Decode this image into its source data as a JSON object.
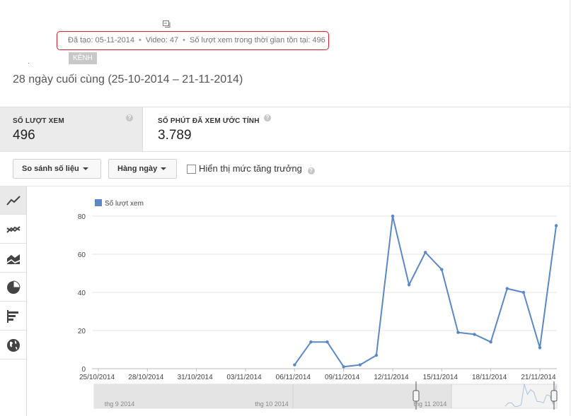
{
  "video_meta": {
    "created_label": "Đã tạo: 05-11-2014",
    "video_label": "Video: 47",
    "lifetime_views_label": "Số lượt xem trong thời gian tồn tại: 496",
    "channel_badge": "KÊNH",
    "export_icon": "export-icon"
  },
  "date_range_title": "28 ngày cuối cùng (25-10-2014 – 21-11-2014)",
  "metrics": [
    {
      "label": "SỐ LƯỢT XEM",
      "value": "496",
      "help_icon": "help-icon"
    },
    {
      "label": "SỐ PHÚT ĐÃ XEM ƯỚC TÍNH",
      "value": "3.789",
      "help_icon": "help-icon"
    }
  ],
  "toolbar": {
    "compare_label": "So sánh số liệu",
    "granularity_label": "Hàng ngày",
    "growth_checkbox_label": "Hiển thị mức tăng trưởng",
    "growth_checked": false
  },
  "side_rail": [
    {
      "name": "line-chart-icon",
      "active": true
    },
    {
      "name": "multi-line-chart-icon",
      "active": false
    },
    {
      "name": "stacked-area-chart-icon",
      "active": false
    },
    {
      "name": "pie-chart-icon",
      "active": false
    },
    {
      "name": "bar-chart-icon",
      "active": false
    },
    {
      "name": "globe-map-icon",
      "active": false
    }
  ],
  "chart_data": {
    "type": "line",
    "legend": "Số lượt xem",
    "legend_position": "top-left",
    "grid": true,
    "color": "#5b88c3",
    "x": [
      "2014-10-25",
      "2014-10-26",
      "2014-10-27",
      "2014-10-28",
      "2014-10-29",
      "2014-10-30",
      "2014-10-31",
      "2014-11-01",
      "2014-11-02",
      "2014-11-03",
      "2014-11-04",
      "2014-11-05",
      "2014-11-06",
      "2014-11-07",
      "2014-11-08",
      "2014-11-09",
      "2014-11-10",
      "2014-11-11",
      "2014-11-12",
      "2014-11-13",
      "2014-11-14",
      "2014-11-15",
      "2014-11-16",
      "2014-11-17",
      "2014-11-18",
      "2014-11-19",
      "2014-11-20",
      "2014-11-21"
    ],
    "values": [
      null,
      null,
      null,
      null,
      null,
      null,
      null,
      null,
      null,
      null,
      null,
      null,
      2,
      14,
      14,
      1,
      2,
      7,
      80,
      44,
      61,
      52,
      19,
      18,
      14,
      42,
      40,
      11,
      75
    ],
    "y_ticks": [
      "0",
      "20",
      "40",
      "60",
      "80"
    ],
    "ylim": [
      0,
      80
    ],
    "x_tick_labels": [
      "25/10/2014",
      "28/10/2014",
      "31/10/2014",
      "03/11/2014",
      "06/11/2014",
      "09/11/2014",
      "12/11/2014",
      "15/11/2014",
      "18/11/2014",
      "21/11/2014"
    ]
  },
  "overview": {
    "labels": [
      "thg 9 2014",
      "thg 10 2014",
      "thg 11 2014"
    ]
  }
}
